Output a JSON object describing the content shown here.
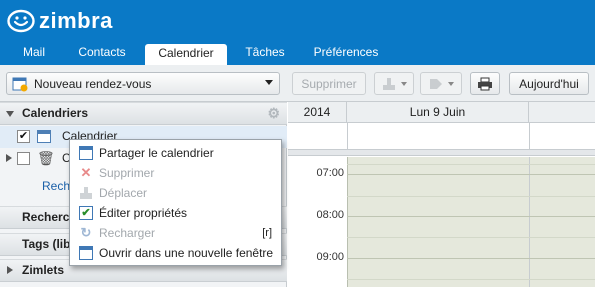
{
  "app": {
    "logo_text": "zimbra",
    "tabs": [
      {
        "label": "Mail"
      },
      {
        "label": "Contacts"
      },
      {
        "label": "Calendrier"
      },
      {
        "label": "Tâches"
      },
      {
        "label": "Préférences"
      }
    ],
    "active_tab": "Calendrier",
    "brand_color": "#0a79c6"
  },
  "toolbar": {
    "new_appointment_label": "Nouveau rendez-vous",
    "delete_label": "Supprimer",
    "today_label": "Aujourd'hui"
  },
  "sidebar": {
    "calendars_header": "Calendriers",
    "calendar_item": "Calendrier",
    "trash_item_partial": "C",
    "search_link_partial": "Reche",
    "search_header_partial": "Recherch",
    "tags_header_partial": "Tags (libe",
    "zimlets_header": "Zimlets"
  },
  "calendar": {
    "year": "2014",
    "day_header": "Lun 9 Juin",
    "times": [
      "07:00",
      "08:00",
      "09:00"
    ]
  },
  "context_menu": {
    "items": [
      {
        "label": "Partager le calendrier",
        "icon": "share-calendar-icon",
        "enabled": true
      },
      {
        "label": "Supprimer",
        "icon": "delete-x-icon",
        "enabled": false
      },
      {
        "label": "Déplacer",
        "icon": "move-icon",
        "enabled": false
      },
      {
        "label": "Éditer propriétés",
        "icon": "edit-properties-icon",
        "enabled": true
      },
      {
        "label": "Recharger",
        "icon": "reload-icon",
        "enabled": false,
        "shortcut": "[r]"
      },
      {
        "label": "Ouvrir dans une nouvelle fenêtre",
        "icon": "new-window-icon",
        "enabled": true
      }
    ]
  }
}
